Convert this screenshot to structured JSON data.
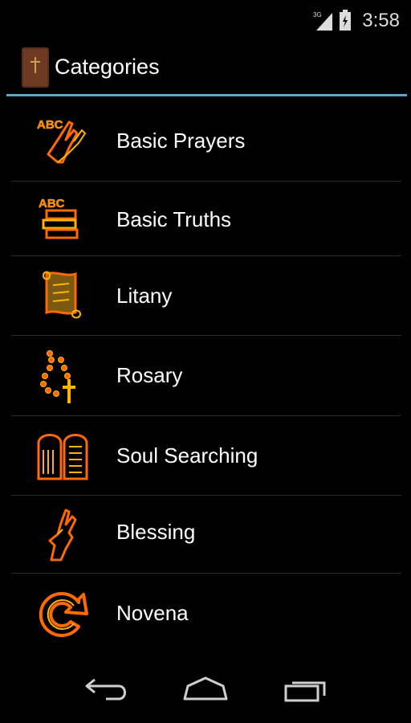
{
  "status_bar": {
    "time": "3:58",
    "network": "3G",
    "signal_icon": "signal-icon",
    "battery_icon": "battery-icon"
  },
  "action_bar": {
    "title": "Categories",
    "app_icon": "bible-icon"
  },
  "categories": [
    {
      "label": "Basic Prayers",
      "icon": "praying-hands-icon"
    },
    {
      "label": "Basic Truths",
      "icon": "books-icon"
    },
    {
      "label": "Litany",
      "icon": "scroll-icon"
    },
    {
      "label": "Rosary",
      "icon": "rosary-icon"
    },
    {
      "label": "Soul Searching",
      "icon": "commandment-tablets-icon"
    },
    {
      "label": "Blessing",
      "icon": "blessing-hand-icon"
    },
    {
      "label": "Novena",
      "icon": "novena-arrow-icon"
    }
  ],
  "nav_bar": {
    "back_icon": "back-icon",
    "home_icon": "home-icon",
    "recents_icon": "recent-apps-icon"
  },
  "colors": {
    "accent_blue": "#59a9cf",
    "icon_orange": "#ff6a00",
    "icon_glow": "#ffb400",
    "background": "#000000",
    "divider": "#2a2a2a"
  }
}
